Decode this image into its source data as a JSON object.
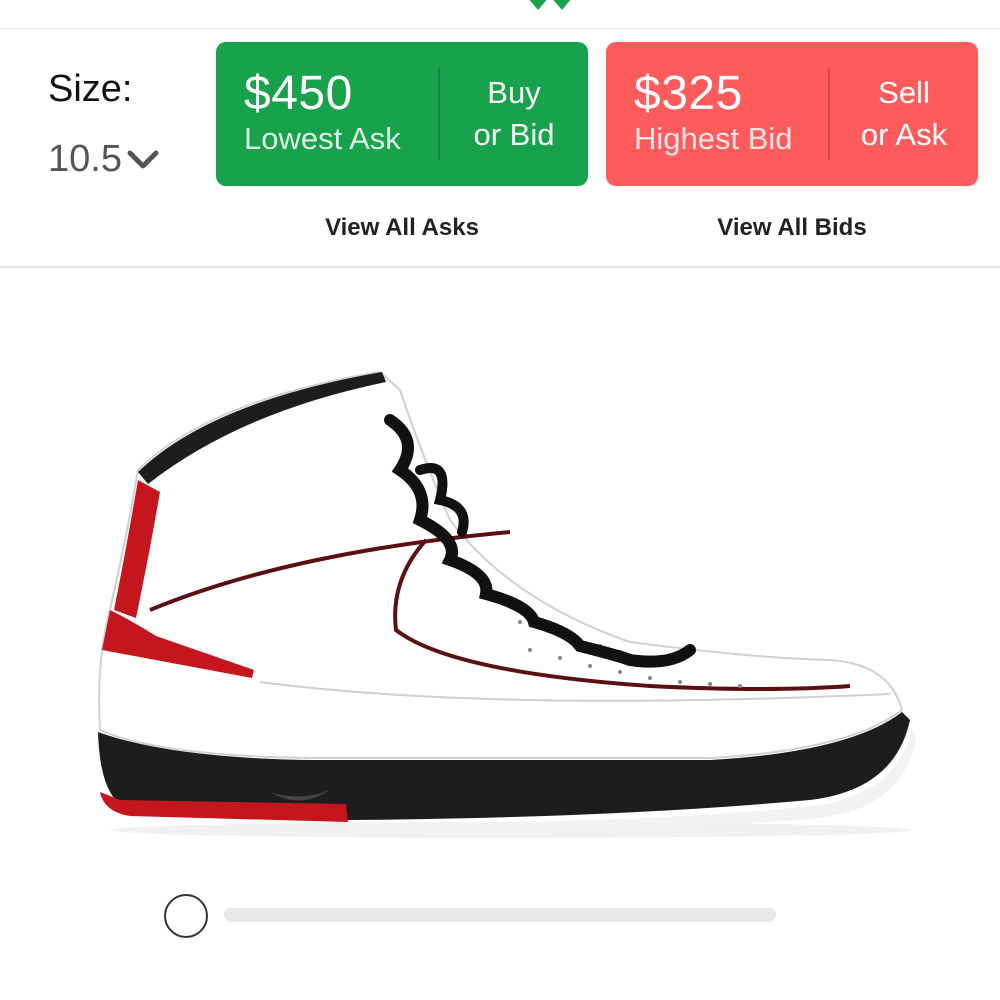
{
  "size": {
    "label": "Size:",
    "value": "10.5",
    "chevron_icon": "chevron-down-icon"
  },
  "buy_button": {
    "price": "$450",
    "subtitle": "Lowest Ask",
    "action_line1": "Buy",
    "action_line2": "or Bid",
    "color": "#17a24b"
  },
  "sell_button": {
    "price": "$325",
    "subtitle": "Highest Bid",
    "action_line1": "Sell",
    "action_line2": "or Ask",
    "color": "#fe5b5d"
  },
  "links": {
    "view_asks": "View All Asks",
    "view_bids": "View All Bids"
  },
  "product": {
    "image_icon": "sneaker-image"
  },
  "viewer_slider": {
    "position": 0
  },
  "brand_color": "#17a24b"
}
